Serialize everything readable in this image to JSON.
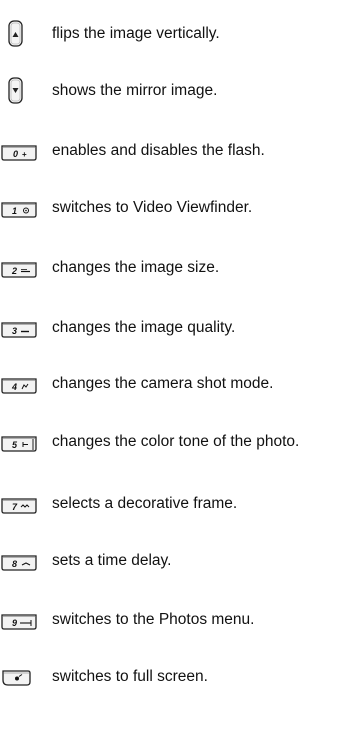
{
  "items": [
    {
      "icon": "up-arrow-key-icon",
      "label": "flips the image vertically."
    },
    {
      "icon": "down-arrow-key-icon",
      "label": "shows the mirror image."
    },
    {
      "icon": "key-0-icon",
      "key_text": "0",
      "label": "enables and disables the flash."
    },
    {
      "icon": "key-1-icon",
      "key_text": "1",
      "label": "switches to Video Viewfinder."
    },
    {
      "icon": "key-2-icon",
      "key_text": "2",
      "label": "changes the image size."
    },
    {
      "icon": "key-3-icon",
      "key_text": "3",
      "label": "changes the image quality."
    },
    {
      "icon": "key-4-icon",
      "key_text": "4",
      "label": "changes the camera shot mode."
    },
    {
      "icon": "key-5-icon",
      "key_text": "5",
      "label": "changes the color tone of the photo."
    },
    {
      "icon": "key-7-icon",
      "key_text": "7",
      "label": "selects a decorative frame."
    },
    {
      "icon": "key-8-icon",
      "key_text": "8",
      "label": "sets a time delay."
    },
    {
      "icon": "key-9-icon",
      "key_text": "9",
      "label": "switches to the Photos menu."
    },
    {
      "icon": "star-key-icon",
      "label": "switches to full screen."
    }
  ]
}
